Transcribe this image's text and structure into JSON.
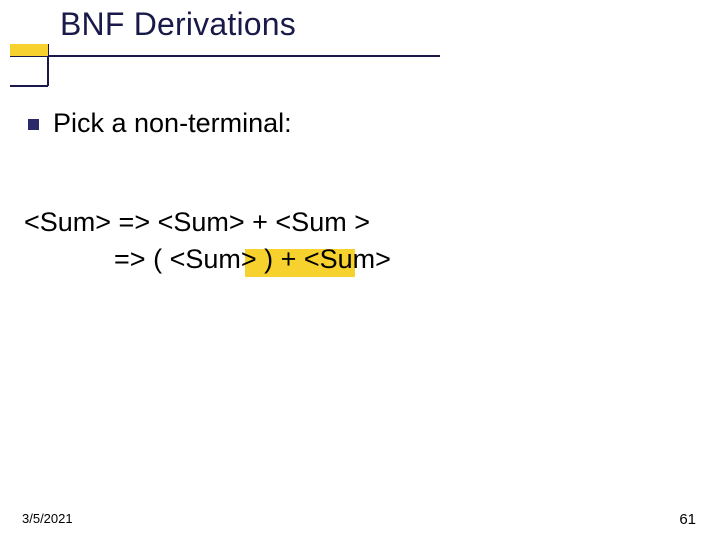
{
  "title": "BNF Derivations",
  "bullet": "Pick a non-terminal:",
  "derivation": {
    "line1": "<Sum> => <Sum> + <Sum >",
    "line2_indent": "            ",
    "line2_a": "=> ( ",
    "line2_h": "<Sum>",
    "line2_b": " ) + <Sum>"
  },
  "footer": {
    "date": "3/5/2021",
    "page": "61"
  },
  "colors": {
    "accent": "#f7d22e",
    "rule": "#1a1a4a"
  }
}
